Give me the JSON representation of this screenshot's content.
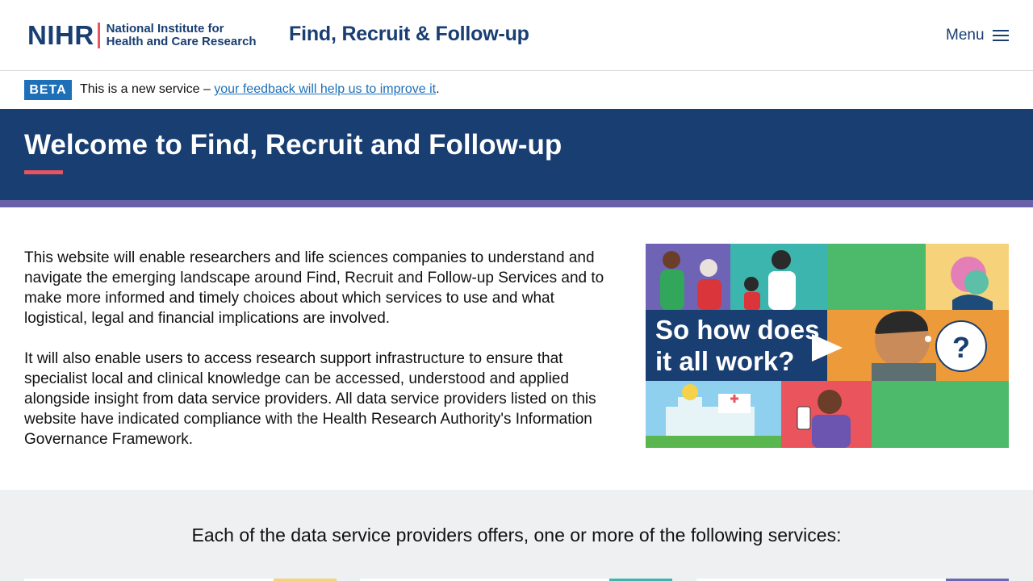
{
  "header": {
    "logo_mark": "NIHR",
    "logo_line1": "National Institute for",
    "logo_line2": "Health and Care Research",
    "service_name": "Find, Recruit & Follow-up",
    "menu_label": "Menu",
    "menu_icon": "hamburger-icon"
  },
  "beta": {
    "tag": "BETA",
    "text_before": "This is a new service – ",
    "link_text": "your feedback will help us to improve it",
    "text_after": "."
  },
  "hero": {
    "title": "Welcome to Find, Recruit and Follow-up"
  },
  "intro": {
    "paragraph1": "This website will enable researchers and life sciences companies to understand and navigate the emerging landscape around Find, Recruit and Follow-up Services and to make more informed and timely choices about which services to use and what logistical, legal and financial implications are involved.",
    "paragraph2": "It will also enable users to access research support infrastructure to ensure that specialist local and clinical knowledge can be accessed, understood and applied alongside insight from data service providers. All data service providers listed on this website have indicated compliance with the Health Research Authority's Information Governance Framework."
  },
  "video": {
    "caption_line1": "So how does",
    "caption_line2": "it all work?",
    "play_icon": "play-icon"
  },
  "services": {
    "heading": "Each of the data service providers offers, one or more of the following services:"
  },
  "colors": {
    "brand_navy": "#193e72",
    "accent_red": "#e9545d",
    "beta_blue": "#1d70b8",
    "stripe_purple": "#6a62a8"
  }
}
